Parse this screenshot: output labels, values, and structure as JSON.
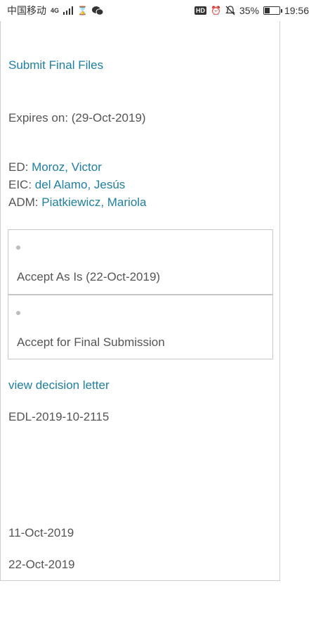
{
  "status_bar": {
    "carrier": "中国移动",
    "network": "4G",
    "battery": "35%",
    "time": "19:56",
    "hd": "HD"
  },
  "content": {
    "submit_final_files": "Submit Final Files",
    "expires_on": "Expires on: (29-Oct-2019)",
    "roles": [
      {
        "role": "ED: ",
        "name": "Moroz, Victor"
      },
      {
        "role": "EIC: ",
        "name": "del Alamo, Jesús"
      },
      {
        "role": "ADM: ",
        "name": "Piatkiewicz, Mariola"
      }
    ],
    "decisions": [
      {
        "label": "Accept As Is (22-Oct-2019)"
      },
      {
        "label": "Accept for Final Submission"
      }
    ],
    "view_decision_letter": "view decision letter",
    "letter_code": "EDL-2019-10-2115",
    "dates": [
      "11-Oct-2019",
      "22-Oct-2019"
    ]
  }
}
